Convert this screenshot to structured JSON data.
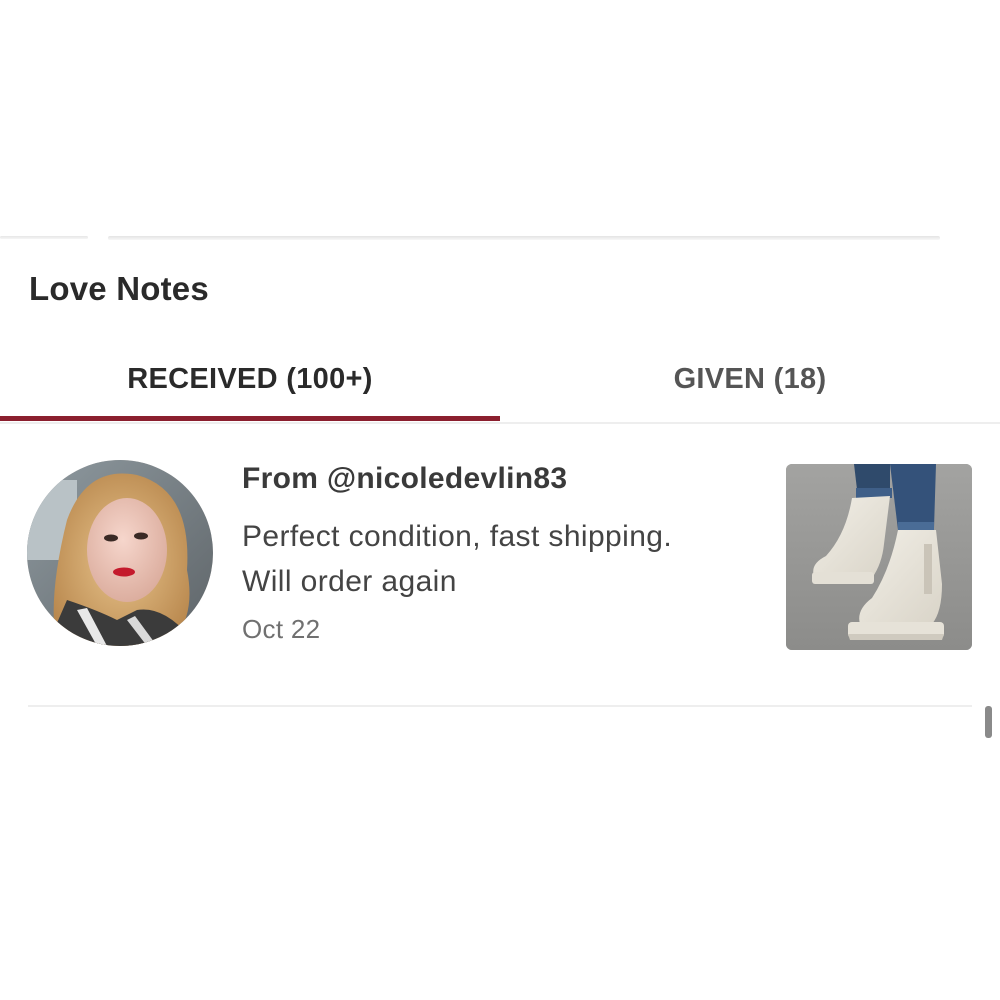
{
  "section": {
    "title": "Love Notes"
  },
  "tabs": [
    {
      "label": "RECEIVED (100+)",
      "active": true
    },
    {
      "label": "GIVEN (18)",
      "active": false
    }
  ],
  "accent_color": "#8b1f2e",
  "notes": [
    {
      "from": "From @nicoledevlin83",
      "message_line1": "Perfect condition, fast shipping.",
      "message_line2": "Will order again",
      "date": "Oct 22"
    }
  ]
}
